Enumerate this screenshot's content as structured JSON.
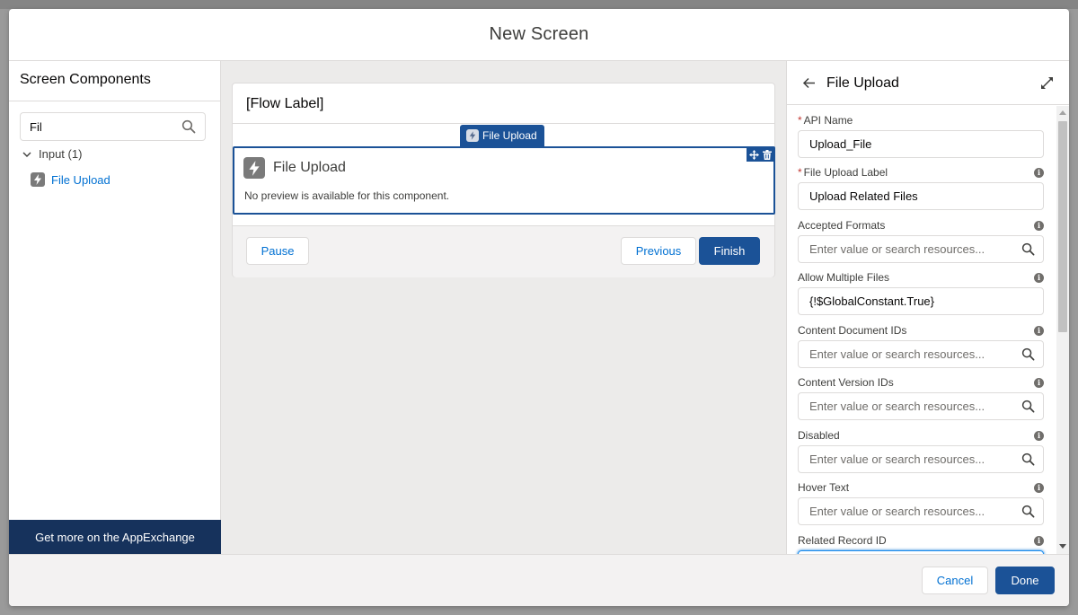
{
  "modal": {
    "title": "New Screen"
  },
  "left_panel": {
    "title": "Screen Components",
    "search_value": "Fil",
    "group_label": "Input (1)",
    "items": [
      {
        "label": "File Upload"
      }
    ],
    "appexchange_label": "Get more on the AppExchange"
  },
  "canvas": {
    "flow_label": "[Flow Label]",
    "badge_label": "File Upload",
    "component_title": "File Upload",
    "component_desc": "No preview is available for this component.",
    "pause_label": "Pause",
    "previous_label": "Previous",
    "finish_label": "Finish"
  },
  "right_panel": {
    "title": "File Upload",
    "fields": [
      {
        "label": "API Name",
        "required": true,
        "value": "Upload_File"
      },
      {
        "label": "File Upload Label",
        "required": true,
        "value": "Upload Related Files"
      },
      {
        "label": "Accepted Formats",
        "placeholder": "Enter value or search resources..."
      },
      {
        "label": "Allow Multiple Files",
        "value": "{!$GlobalConstant.True}"
      },
      {
        "label": "Content Document IDs",
        "placeholder": "Enter value or search resources..."
      },
      {
        "label": "Content Version IDs",
        "placeholder": "Enter value or search resources..."
      },
      {
        "label": "Disabled",
        "placeholder": "Enter value or search resources..."
      },
      {
        "label": "Hover Text",
        "placeholder": "Enter value or search resources..."
      },
      {
        "label": "Related Record ID",
        "value": ""
      }
    ]
  },
  "footer": {
    "cancel_label": "Cancel",
    "done_label": "Done"
  },
  "colors": {
    "brand": "#1b5297",
    "link": "#0070d2",
    "appexchange_bg": "#16325c",
    "required": "#c23934"
  }
}
